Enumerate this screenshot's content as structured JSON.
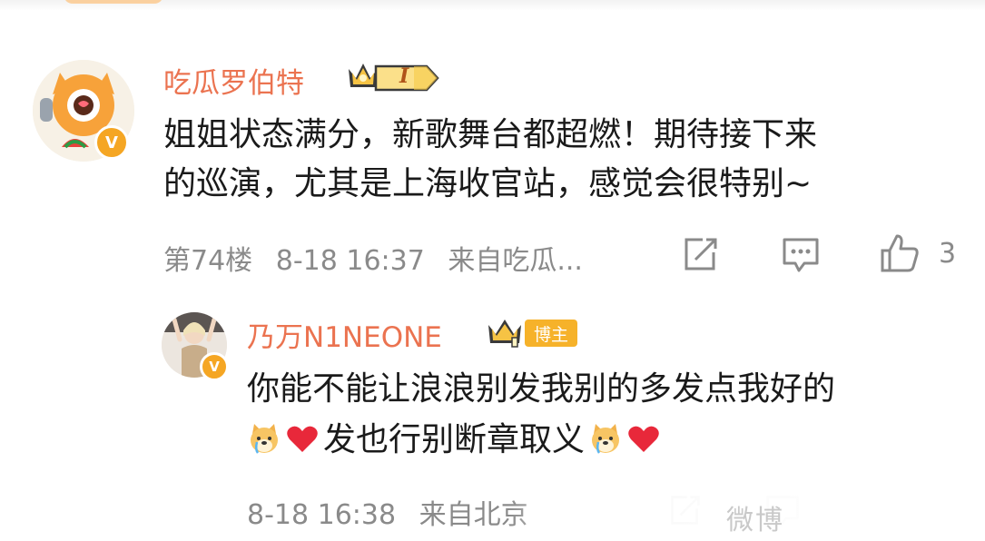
{
  "comment": {
    "username": "吃瓜罗伯特",
    "level_badge": "I",
    "text_line1": "姐姐状态满分，新歌舞台都超燃！期待接下来",
    "text_line2": "的巡演，尤其是上海收官站，感觉会很特别~",
    "floor": "第74楼",
    "time": "8-18 16:37",
    "source": "来自吃瓜...",
    "like_count": "3"
  },
  "reply": {
    "username": "乃万N1NEONE",
    "role_badge": "博主",
    "text_line1": "你能不能让浪浪别发我别的多发点我好的",
    "text_line2": "发也行别断章取义",
    "time": "8-18 16:38",
    "source": "来自北京"
  },
  "watermark": "微博",
  "colors": {
    "username": "#eb7350",
    "meta": "#8a8a8a",
    "badge_gold": "#f6b22a"
  }
}
